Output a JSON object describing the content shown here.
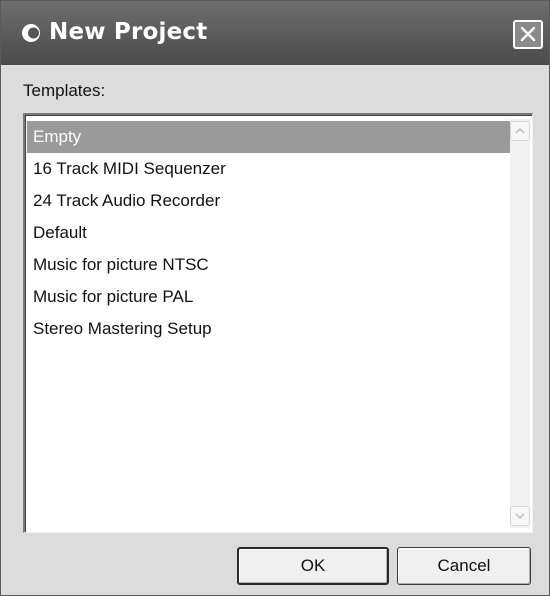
{
  "window": {
    "title": "New Project",
    "icon": "app-logo-icon",
    "close_icon": "close-icon"
  },
  "templates_label": "Templates:",
  "templates": [
    {
      "label": "Empty",
      "selected": true
    },
    {
      "label": "16 Track MIDI Sequenzer",
      "selected": false
    },
    {
      "label": "24 Track Audio Recorder",
      "selected": false
    },
    {
      "label": "Default",
      "selected": false
    },
    {
      "label": "Music for picture NTSC",
      "selected": false
    },
    {
      "label": "Music for picture PAL",
      "selected": false
    },
    {
      "label": "Stereo Mastering Setup",
      "selected": false
    }
  ],
  "buttons": {
    "ok_label": "OK",
    "cancel_label": "Cancel"
  },
  "colors": {
    "titlebar": "#5a5a5a",
    "selection": "#9a9a9a",
    "dialog_bg": "#dcdcdc"
  }
}
